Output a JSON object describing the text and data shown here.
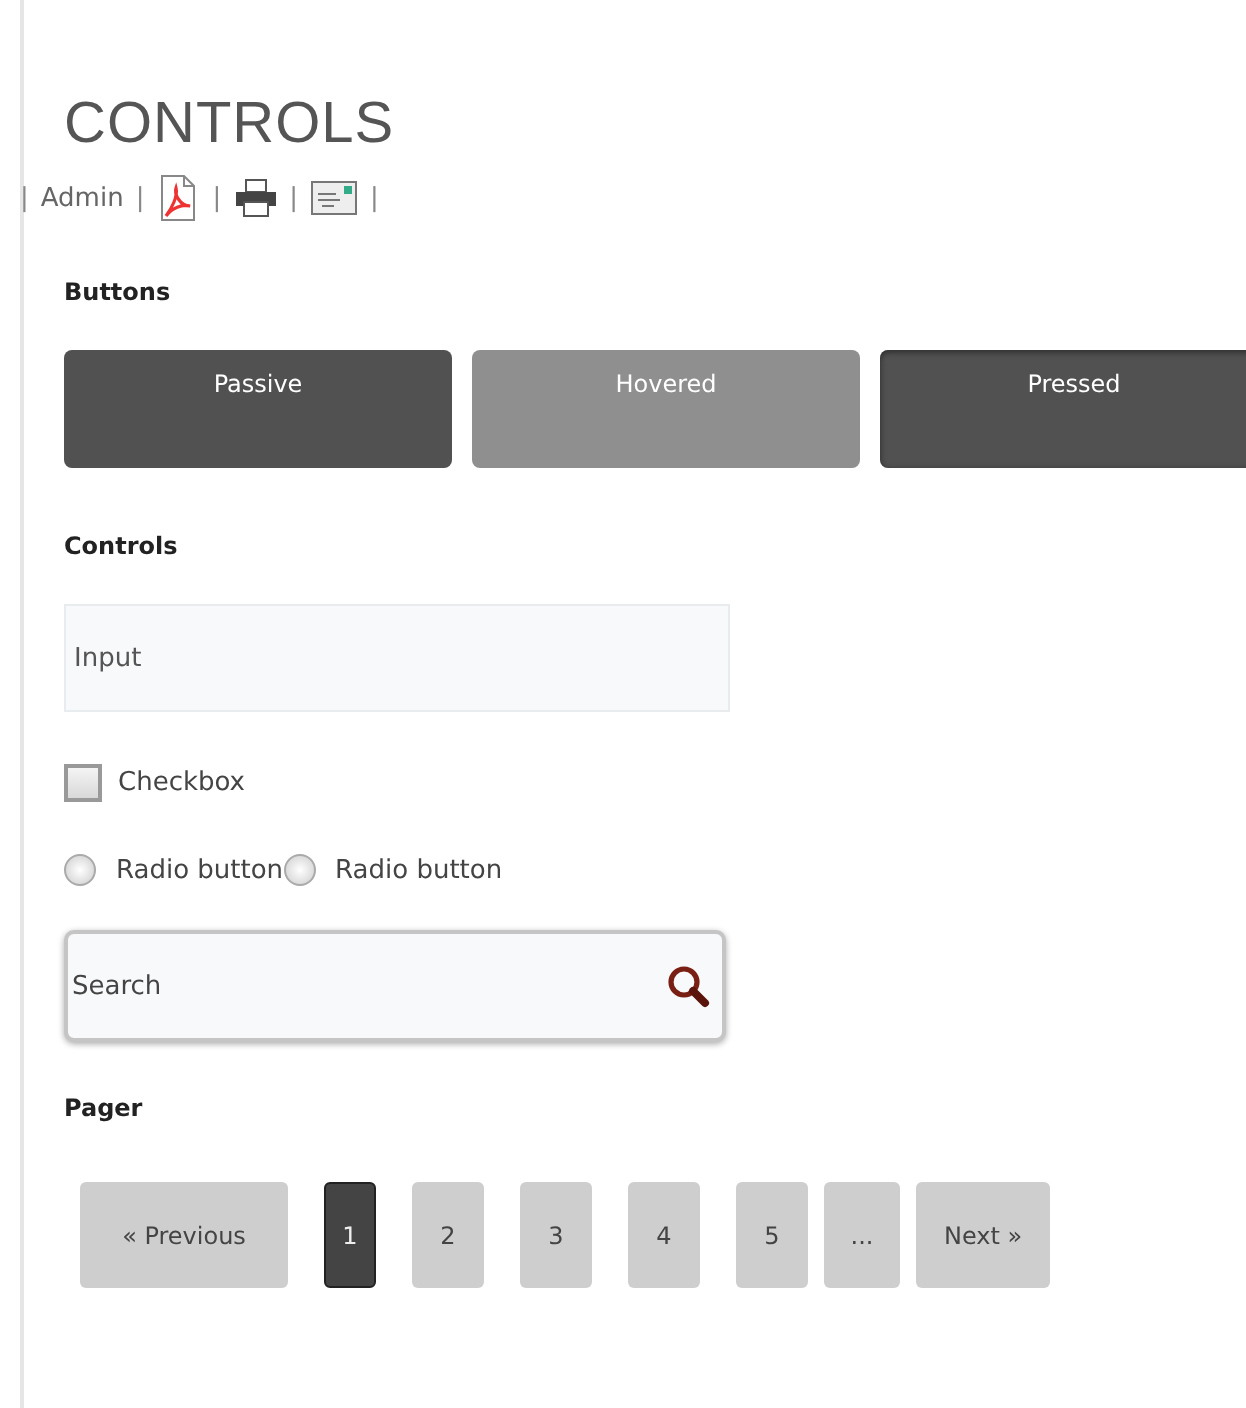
{
  "title": "CONTROLS",
  "toolbar": {
    "separators": [
      "|",
      "|",
      "|",
      "|",
      "|"
    ],
    "link": "Admin"
  },
  "sections": [
    {
      "heading": "Buttons"
    },
    {
      "heading": "Controls"
    },
    {
      "heading": "Pager"
    }
  ],
  "buttons": [
    {
      "label": "Passive",
      "hovered": false,
      "pressed": false
    },
    {
      "label": "Hovered",
      "hovered": true,
      "pressed": false
    },
    {
      "label": "Pressed",
      "hovered": false,
      "pressed": true
    }
  ],
  "input": {
    "placeholder": "Input"
  },
  "checkbox": {
    "label": "Checkbox",
    "checked": false
  },
  "radios": [
    {
      "label": "Radio button",
      "selected": false
    },
    {
      "label": "Radio button",
      "selected": false
    }
  ],
  "search": {
    "placeholder": "Search"
  },
  "pager": [
    {
      "kind": "prev",
      "text": "« Previous",
      "selected": false
    },
    {
      "kind": "page",
      "text": "1",
      "selected": true
    },
    {
      "kind": "page",
      "text": "2",
      "selected": false
    },
    {
      "kind": "page",
      "text": "3",
      "selected": false
    },
    {
      "kind": "page",
      "text": "4",
      "selected": false
    },
    {
      "kind": "page",
      "text": "5",
      "selected": false
    },
    {
      "kind": "ellipsis",
      "text": "...",
      "selected": false
    },
    {
      "kind": "next",
      "text": "Next »",
      "selected": false
    }
  ]
}
